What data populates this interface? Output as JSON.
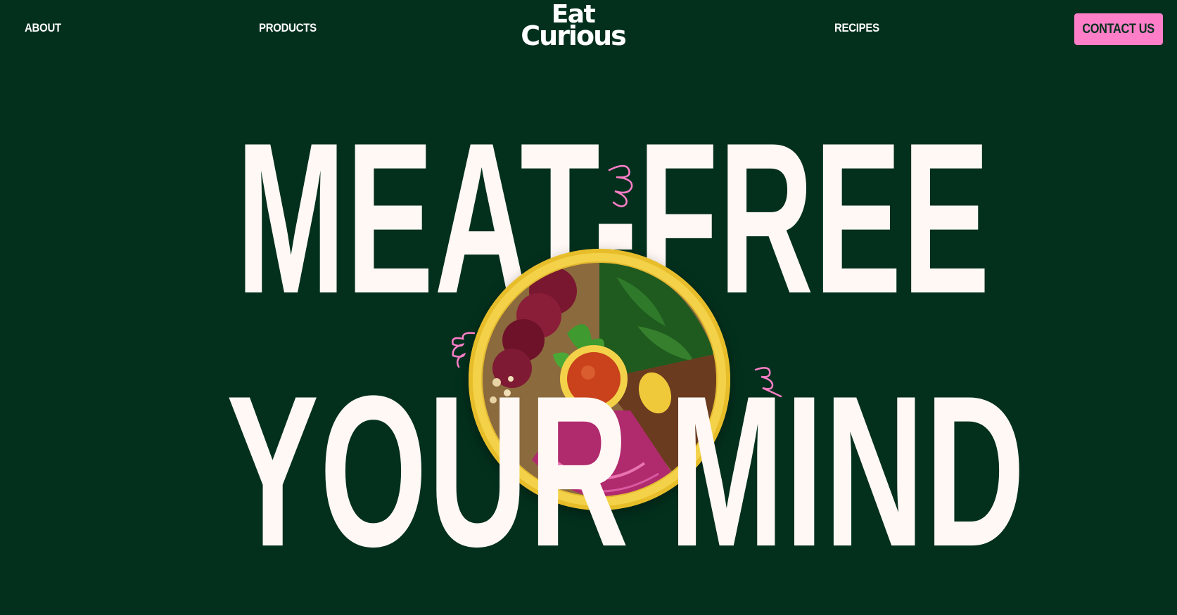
{
  "nav": {
    "about": "ABOUT",
    "products": "PRODUCTS",
    "recipes": "RECIPES",
    "contact": "CONTACT US"
  },
  "logo": {
    "line1": "Eat",
    "line2": "Curious"
  },
  "hero": {
    "line1": "MEAT-FREE",
    "line2": "YOUR MIND"
  },
  "colors": {
    "background": "#03301d",
    "text": "#fff8f4",
    "accent_pink": "#ff7ec8",
    "bowl_yellow": "#f2cf3e"
  },
  "icons": {
    "bowl": "food-bowl-image",
    "squiggles": "squiggle-doodle-icon"
  }
}
